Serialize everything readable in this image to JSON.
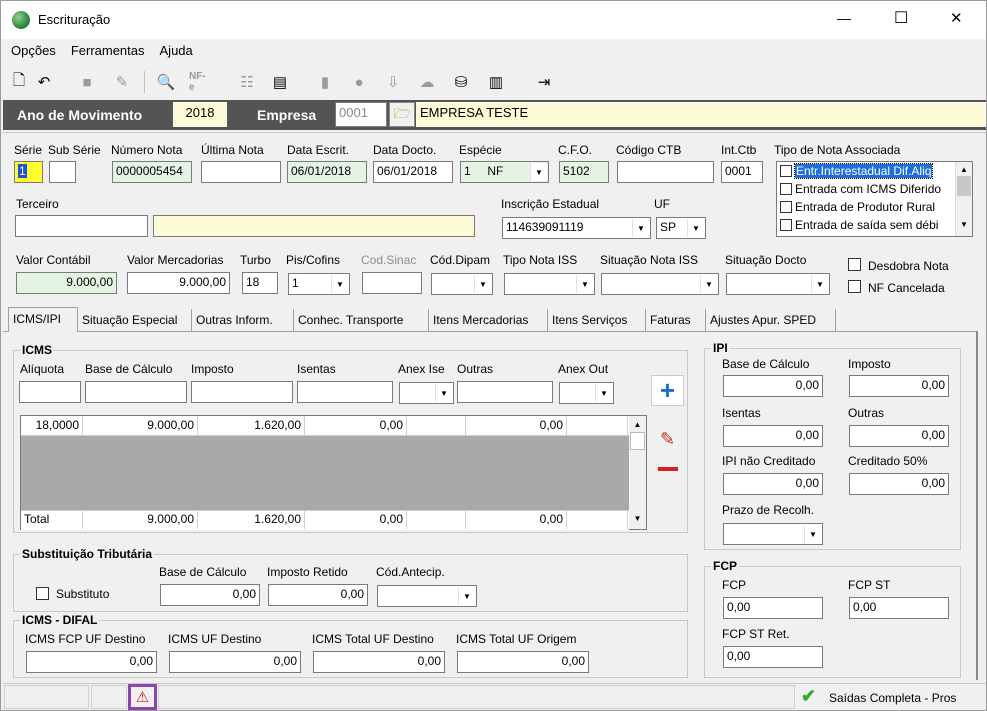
{
  "window": {
    "title": "Escrituração",
    "min": "—",
    "max": "☐",
    "close": "✕"
  },
  "menu": [
    "Opções",
    "Ferramentas",
    "Ajuda"
  ],
  "toolbar": {
    "icons": [
      "new-icon",
      "undo-icon",
      "stop-icon",
      "tools-icon",
      "preview-icon",
      "nfe-icon",
      "tree-icon",
      "scanner-icon",
      "folder-icon",
      "apple-icon",
      "download-icon",
      "cloud-icon",
      "coins-icon",
      "columns-icon",
      "exit-icon"
    ],
    "nfe_label": "NF-e"
  },
  "header": {
    "ano_label": "Ano de Movimento",
    "ano": "2018",
    "empresa_label": "Empresa",
    "empresa_code": "0001",
    "empresa_name": "EMPRESA TESTE"
  },
  "form": {
    "serie": {
      "label": "Série",
      "value": "1"
    },
    "subserie": {
      "label": "Sub Série",
      "value": ""
    },
    "numero": {
      "label": "Número Nota",
      "value": "0000005454"
    },
    "ultima": {
      "label": "Última Nota",
      "value": ""
    },
    "data_escrit": {
      "label": "Data Escrit.",
      "value": "06/01/2018"
    },
    "data_docto": {
      "label": "Data Docto.",
      "value": "06/01/2018"
    },
    "especie": {
      "label": "Espécie",
      "value": "1     NF"
    },
    "cfo": {
      "label": "C.F.O.",
      "value": "5102"
    },
    "codigo_ctb": {
      "label": "Código CTB",
      "value": ""
    },
    "int_ctb": {
      "label": "Int.Ctb",
      "value": "0001"
    },
    "tipo_nota": {
      "label": "Tipo de Nota Associada",
      "items": [
        "Entr.Interestadual Dif.Aliq",
        "Entrada com ICMS Diferido",
        "Entrada de Produtor Rural",
        "Entrada de saída sem débi"
      ]
    },
    "terceiro": {
      "label": "Terceiro",
      "code": "",
      "name": ""
    },
    "ie": {
      "label": "Inscrição Estadual",
      "value": "114639091119"
    },
    "uf": {
      "label": "UF",
      "value": "SP"
    },
    "valor_contabil": {
      "label": "Valor Contábil",
      "value": "9.000,00"
    },
    "valor_merc": {
      "label": "Valor Mercadorias",
      "value": "9.000,00"
    },
    "turbo": {
      "label": "Turbo",
      "value": "18"
    },
    "pis": {
      "label": "Pis/Cofins",
      "value": "1"
    },
    "cod_sinac": {
      "label": "Cod.Sinac",
      "value": ""
    },
    "cod_dipam": {
      "label": "Cód.Dipam",
      "value": ""
    },
    "tipo_iss": {
      "label": "Tipo Nota ISS",
      "value": ""
    },
    "sit_iss": {
      "label": "Situação Nota ISS",
      "value": ""
    },
    "sit_docto": {
      "label": "Situação Docto",
      "value": ""
    },
    "desdobra": "Desdobra Nota",
    "cancelada": "NF Cancelada"
  },
  "tabs": [
    "ICMS/IPI",
    "Situação Especial",
    "Outras Inform.",
    "Conhec. Transporte",
    "Itens Mercadorias",
    "Itens Serviços",
    "Faturas",
    "Ajustes Apur. SPED"
  ],
  "icms": {
    "title": "ICMS",
    "labels": [
      "Alíquota",
      "Base de Cálculo",
      "Imposto",
      "Isentas",
      "Anex Ise",
      "Outras",
      "Anex Out"
    ],
    "row": [
      "18,0000",
      "9.000,00",
      "1.620,00",
      "0,00",
      "",
      "0,00",
      ""
    ],
    "total": [
      "Total",
      "9.000,00",
      "1.620,00",
      "0,00",
      "",
      "0,00",
      ""
    ]
  },
  "st": {
    "title": "Substituição Tributária",
    "substituto": "Substituto",
    "base_label": "Base de Cálculo",
    "base": "0,00",
    "retido_label": "Imposto Retido",
    "retido": "0,00",
    "antecip_label": "Cód.Antecip."
  },
  "difal": {
    "title": "ICMS - DIFAL",
    "fcp_label": "ICMS FCP UF Destino",
    "fcp": "0,00",
    "dest_label": "ICMS UF Destino",
    "dest": "0,00",
    "total_dest_label": "ICMS Total UF Destino",
    "total_dest": "0,00",
    "total_orig_label": "ICMS Total UF Origem",
    "total_orig": "0,00"
  },
  "ipi": {
    "title": "IPI",
    "base_label": "Base de Cálculo",
    "base": "0,00",
    "imposto_label": "Imposto",
    "imposto": "0,00",
    "isentas_label": "Isentas",
    "isentas": "0,00",
    "outras_label": "Outras",
    "outras": "0,00",
    "nao_cred_label": "IPI não Creditado",
    "nao_cred": "0,00",
    "cred50_label": "Creditado 50%",
    "cred50": "0,00",
    "prazo_label": "Prazo de Recolh."
  },
  "fcp": {
    "title": "FCP",
    "fcp_label": "FCP",
    "fcp": "0,00",
    "st_label": "FCP ST",
    "st": "0,00",
    "st_ret_label": "FCP ST Ret.",
    "st_ret": "0,00"
  },
  "status": {
    "text": "Saídas Completa - Pros"
  },
  "colors": {
    "header_bar": "#545454",
    "accent_blue": "#1f6fd1",
    "minus_red": "#d42020",
    "status_warn": "#8e44ad"
  }
}
